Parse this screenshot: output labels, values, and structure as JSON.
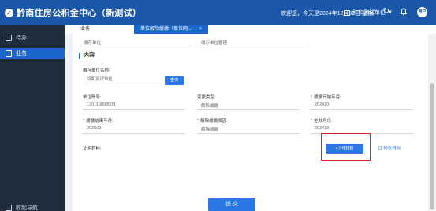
{
  "header": {
    "title": "黔南住房公积金中心（新测试）",
    "welcome": "欢迎您，今天是2024年12月09日 星期一",
    "unit_name": "和和测试单位",
    "avatar_text": "用户"
  },
  "sidebar": {
    "items": [
      {
        "label": "待办"
      },
      {
        "label": "业务"
      }
    ],
    "collapse_label": "收起导航"
  },
  "tabs": [
    {
      "label": "业务"
    },
    {
      "label": "单位解除缓缴（单位网..."
    }
  ],
  "form": {
    "top_fields": [
      {
        "label": "缴存单位"
      },
      {
        "label": "缴存单位管理"
      }
    ],
    "section_title": "内容",
    "unit_name_label": "缴存单位名称:",
    "unit_name_value": "和和测试单位",
    "query_button": "查询",
    "account_label": "单位账号:",
    "account_value": "130110098509",
    "change_type_label": "变更类型:",
    "change_type_value": "解除缓缴",
    "defer_start_label": "缓缴开始年月:",
    "defer_start_value": "202410",
    "defer_end_label": "缓缴结束年月:",
    "defer_end_value": "202509",
    "reason_label": "解除缓缴原因:",
    "reason_value": "解除缓缴",
    "effective_label": "生效月份:",
    "effective_value": "202410",
    "material_label": "证明材料:",
    "upload_button": "+上传材料",
    "preview_link": "预览材料",
    "submit_button": "提 交"
  },
  "colors": {
    "header_bg": "#1a57a8",
    "sidebar_bg": "#1f2d3d",
    "accent": "#2b78e4",
    "highlight_box": "#e02020"
  }
}
